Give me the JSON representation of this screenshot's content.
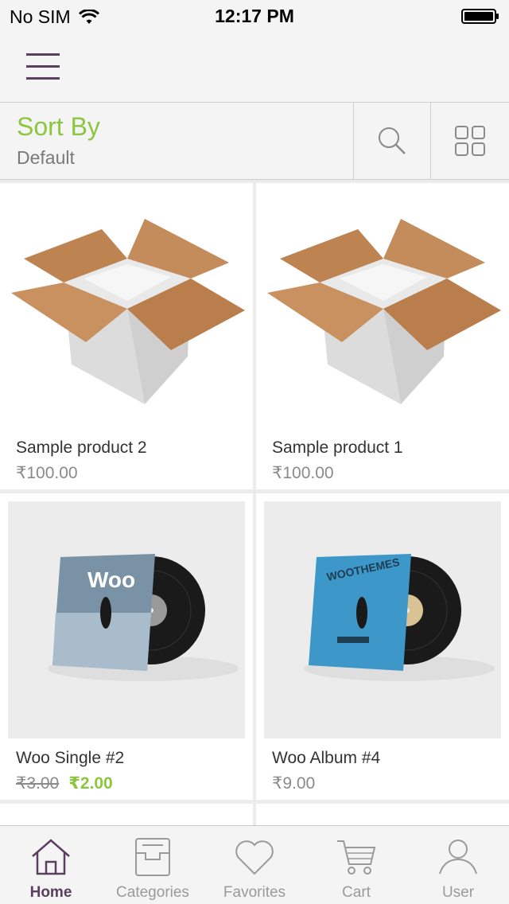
{
  "status_bar": {
    "carrier": "No SIM",
    "time": "12:17 PM"
  },
  "navbar": {
    "menu_icon": "hamburger-menu-icon"
  },
  "toolbar": {
    "sort_title": "Sort By",
    "sort_value": "Default",
    "search_icon": "search-icon",
    "grid_icon": "grid-view-icon"
  },
  "colors": {
    "accent_green": "#8cc63f",
    "brand_purple": "#5b3f5f"
  },
  "products": [
    {
      "name": "Sample product 2",
      "price": "₹100.00",
      "image": "open-cardboard-box"
    },
    {
      "name": "Sample product 1",
      "price": "₹100.00",
      "image": "open-cardboard-box"
    },
    {
      "name": "Woo Single #2",
      "regular_price": "₹3.00",
      "sale_price": "₹2.00",
      "image": "vinyl-record-woo-single"
    },
    {
      "name": "Woo Album #4",
      "price": "₹9.00",
      "image": "vinyl-record-woothemes-album"
    }
  ],
  "tabbar": {
    "tabs": [
      {
        "label": "Home",
        "icon": "home-icon",
        "active": true
      },
      {
        "label": "Categories",
        "icon": "inbox-tray-icon",
        "active": false
      },
      {
        "label": "Favorites",
        "icon": "heart-icon",
        "active": false
      },
      {
        "label": "Cart",
        "icon": "cart-icon",
        "active": false
      },
      {
        "label": "User",
        "icon": "user-icon",
        "active": false
      }
    ]
  }
}
